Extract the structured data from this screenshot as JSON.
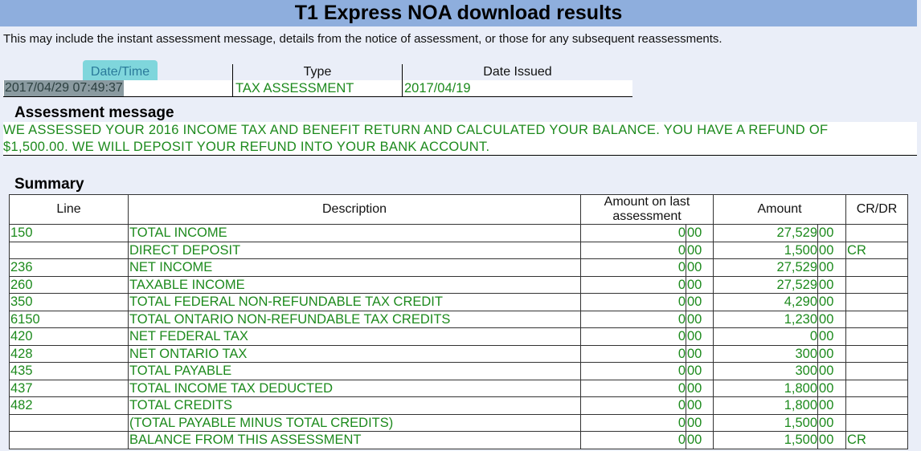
{
  "title": "T1 Express NOA download results",
  "intro": "This may include the instant assessment message, details from the notice of assessment, or those for any subsequent reassessments.",
  "header": {
    "datetime_label": "Date/Time",
    "type_label": "Type",
    "date_issued_label": "Date Issued",
    "datetime_value": "2017/04/29 07:49:37",
    "type_value": "TAX ASSESSMENT",
    "date_issued_value": "2017/04/19"
  },
  "assessment": {
    "heading": "Assessment message",
    "line1": "WE ASSESSED YOUR 2016 INCOME TAX AND BENEFIT RETURN AND CALCULATED YOUR BALANCE. YOU HAVE A REFUND OF",
    "line2": "$1,500.00. WE WILL DEPOSIT YOUR REFUND INTO YOUR BANK ACCOUNT."
  },
  "summary": {
    "heading": "Summary",
    "columns": [
      "Line",
      "Description",
      "Amount on last assessment",
      "Amount",
      "CR/DR"
    ],
    "rows": [
      {
        "line": "150",
        "desc": "TOTAL INCOME",
        "last": "0",
        "last_c": "00",
        "amt": "27,529",
        "amt_c": "00",
        "crdr": ""
      },
      {
        "line": "",
        "desc": "DIRECT DEPOSIT",
        "last": "0",
        "last_c": "00",
        "amt": "1,500",
        "amt_c": "00",
        "crdr": "CR"
      },
      {
        "line": "236",
        "desc": "NET INCOME",
        "last": "0",
        "last_c": "00",
        "amt": "27,529",
        "amt_c": "00",
        "crdr": ""
      },
      {
        "line": "260",
        "desc": "TAXABLE INCOME",
        "last": "0",
        "last_c": "00",
        "amt": "27,529",
        "amt_c": "00",
        "crdr": ""
      },
      {
        "line": "350",
        "desc": "TOTAL FEDERAL NON-REFUNDABLE TAX CREDIT",
        "last": "0",
        "last_c": "00",
        "amt": "4,290",
        "amt_c": "00",
        "crdr": ""
      },
      {
        "line": "6150",
        "desc": "TOTAL ONTARIO NON-REFUNDABLE TAX CREDITS",
        "last": "0",
        "last_c": "00",
        "amt": "1,230",
        "amt_c": "00",
        "crdr": ""
      },
      {
        "line": "420",
        "desc": "NET FEDERAL TAX",
        "last": "0",
        "last_c": "00",
        "amt": "0",
        "amt_c": "00",
        "crdr": ""
      },
      {
        "line": "428",
        "desc": "NET ONTARIO TAX",
        "last": "0",
        "last_c": "00",
        "amt": "300",
        "amt_c": "00",
        "crdr": ""
      },
      {
        "line": "435",
        "desc": "TOTAL PAYABLE",
        "last": "0",
        "last_c": "00",
        "amt": "300",
        "amt_c": "00",
        "crdr": ""
      },
      {
        "line": "437",
        "desc": "TOTAL INCOME TAX DEDUCTED",
        "last": "0",
        "last_c": "00",
        "amt": "1,800",
        "amt_c": "00",
        "crdr": ""
      },
      {
        "line": "482",
        "desc": "TOTAL CREDITS",
        "last": "0",
        "last_c": "00",
        "amt": "1,800",
        "amt_c": "00",
        "crdr": ""
      },
      {
        "line": "",
        "desc": "(TOTAL PAYABLE MINUS TOTAL CREDITS)",
        "last": "0",
        "last_c": "00",
        "amt": "1,500",
        "amt_c": "00",
        "crdr": ""
      },
      {
        "line": "",
        "desc": "BALANCE FROM THIS ASSESSMENT",
        "last": "0",
        "last_c": "00",
        "amt": "1,500",
        "amt_c": "00",
        "crdr": "CR"
      }
    ]
  }
}
